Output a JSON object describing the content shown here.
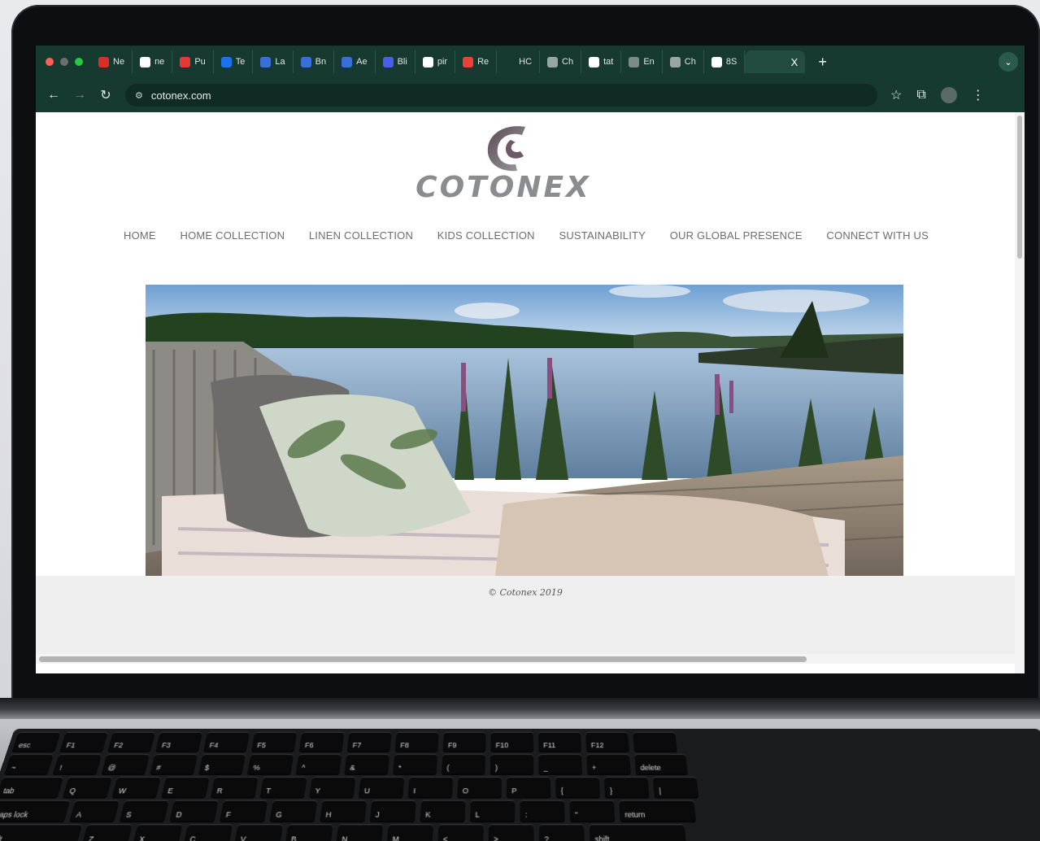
{
  "browser": {
    "tabs": [
      {
        "label": "Ne",
        "color": "#d93025"
      },
      {
        "label": "ne",
        "color": "#ffffff"
      },
      {
        "label": "Pu",
        "color": "#e53935"
      },
      {
        "label": "Te",
        "color": "#1a73e8"
      },
      {
        "label": "La",
        "color": "#3b6fd8"
      },
      {
        "label": "Bn",
        "color": "#3b6fd8"
      },
      {
        "label": "Ae",
        "color": "#3b6fd8"
      },
      {
        "label": "Bli",
        "color": "#4b5ee8"
      },
      {
        "label": "pir",
        "color": "#ffffff"
      },
      {
        "label": "Re",
        "color": "#ea4335"
      },
      {
        "label": "HC",
        "color": "#173a30"
      },
      {
        "label": "Ch",
        "color": "#9aa6a2"
      },
      {
        "label": "tat",
        "color": "#ffffff"
      },
      {
        "label": "En",
        "color": "#7d8a86"
      },
      {
        "label": "Ch",
        "color": "#9aa6a2"
      },
      {
        "label": "8S",
        "color": "#ffffff"
      }
    ],
    "active_tab_close": "X",
    "new_tab": "+",
    "tab_menu": "⌄",
    "url": "cotonex.com"
  },
  "site": {
    "logo_text": "COTONEX",
    "nav": [
      "HOME",
      "HOME COLLECTION",
      "LINEN COLLECTION",
      "KIDS COLLECTION",
      "SUSTAINABILITY",
      "OUR GLOBAL PRESENCE",
      "CONNECT WITH US"
    ],
    "copyright": "© Cotonex 2019"
  },
  "colors": {
    "browser_chrome": "#173a30",
    "logo_gray": "#8b8c8f",
    "footer_bg": "#efefef"
  },
  "keyboard": {
    "rows": [
      [
        "esc",
        "F1",
        "F2",
        "F3",
        "F4",
        "F5",
        "F6",
        "F7",
        "F8",
        "F9",
        "F10",
        "F11",
        "F12",
        ""
      ],
      [
        "~",
        "!",
        "@",
        "#",
        "$",
        "%",
        "^",
        "&",
        "*",
        "(",
        ")",
        "_",
        "+",
        "delete"
      ],
      [
        "tab",
        "Q",
        "W",
        "E",
        "R",
        "T",
        "Y",
        "U",
        "I",
        "O",
        "P",
        "{",
        "}",
        "|"
      ],
      [
        "caps lock",
        "A",
        "S",
        "D",
        "F",
        "G",
        "H",
        "J",
        "K",
        "L",
        ":",
        "\"",
        "return"
      ],
      [
        "shift",
        "Z",
        "X",
        "C",
        "V",
        "B",
        "N",
        "M",
        "<",
        ">",
        "?",
        "shift"
      ]
    ]
  }
}
